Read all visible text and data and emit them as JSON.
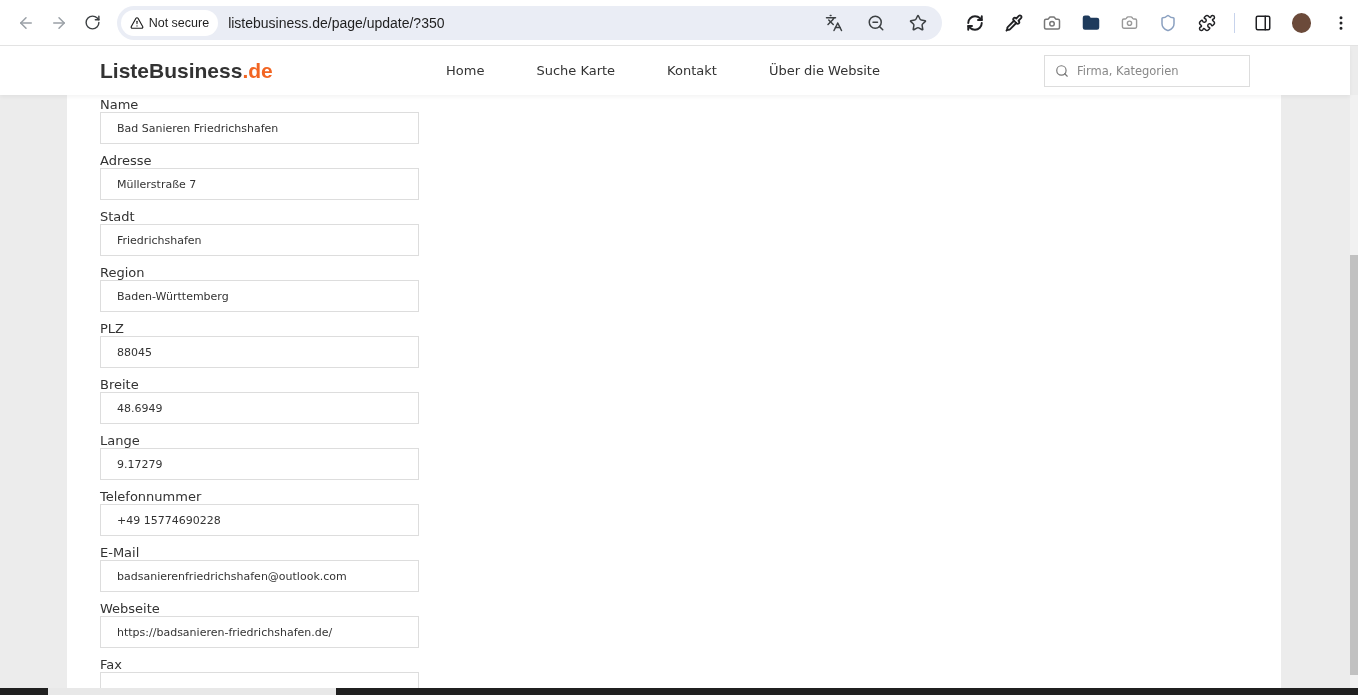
{
  "browser": {
    "security_label": "Not secure",
    "url": "listebusiness.de/page/update/?350"
  },
  "site": {
    "logo_main": "ListeBusiness",
    "logo_accent": ".de",
    "nav": [
      "Home",
      "Suche Karte",
      "Kontakt",
      "Über die Website"
    ],
    "search_placeholder": "Firma, Kategorien"
  },
  "form": {
    "fields": [
      {
        "label": "Name",
        "value": "Bad Sanieren Friedrichshafen"
      },
      {
        "label": "Adresse",
        "value": "Müllerstraße 7"
      },
      {
        "label": "Stadt",
        "value": "Friedrichshafen"
      },
      {
        "label": "Region",
        "value": "Baden-Württemberg"
      },
      {
        "label": "PLZ",
        "value": "88045"
      },
      {
        "label": "Breite",
        "value": "48.6949"
      },
      {
        "label": "Lange",
        "value": "9.17279"
      },
      {
        "label": "Telefonnummer",
        "value": "+49 15774690228"
      },
      {
        "label": "E-Mail",
        "value": "badsanierenfriedrichshafen@outlook.com"
      },
      {
        "label": "Webseite",
        "value": "https://badsanieren-friedrichshafen.de/"
      },
      {
        "label": "Fax"
      }
    ]
  }
}
